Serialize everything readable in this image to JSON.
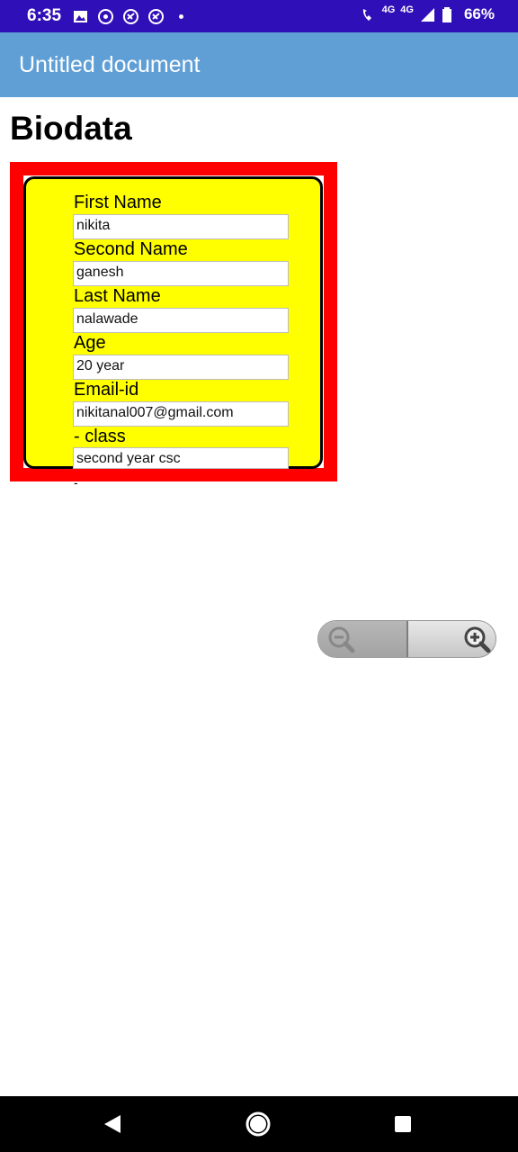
{
  "status_bar": {
    "time": "6:35",
    "network_small": "4G",
    "network": "4G",
    "battery": "66%",
    "icons": [
      "image-icon",
      "whatsapp-icon",
      "app-icon",
      "app-icon",
      "dot-icon",
      "wifi-call-icon",
      "signal-icon",
      "battery-icon"
    ]
  },
  "app_bar": {
    "title": "Untitled document"
  },
  "page": {
    "heading": "Biodata"
  },
  "form": {
    "fields": [
      {
        "label": "First Name",
        "value": "nikita"
      },
      {
        "label": "Second Name",
        "value": "ganesh"
      },
      {
        "label": "Last Name",
        "value": "nalawade"
      },
      {
        "label": "Age",
        "value": "20 year"
      },
      {
        "label": "Email-id",
        "value": "nikitanal007@gmail.com"
      },
      {
        "label": "- class",
        "value": "second year csc"
      }
    ],
    "trailing_mark": "-",
    "colors": {
      "outer": "#ff0000",
      "inner": "#ffff00",
      "border": "#000000"
    }
  },
  "zoom": {
    "out_icon": "zoom-out-icon",
    "in_icon": "zoom-in-icon"
  },
  "nav_bar": {
    "icons": [
      "back-icon",
      "home-icon",
      "recents-icon"
    ]
  }
}
